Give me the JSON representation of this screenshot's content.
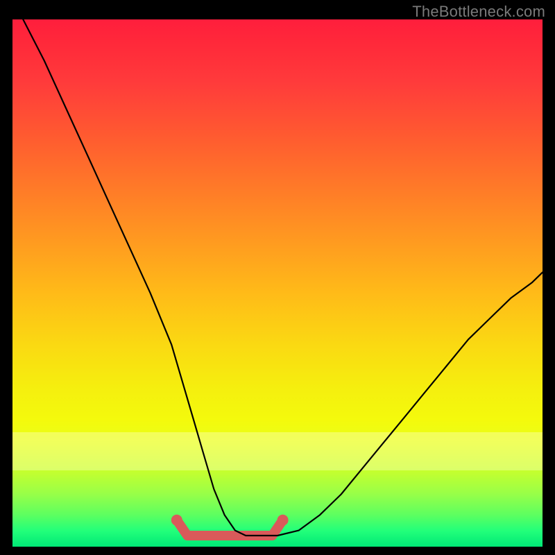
{
  "watermark": "TheBottleneck.com",
  "colors": {
    "curve": "#000000",
    "accent": "#d95a5a",
    "gradient_top": "#ff1e3c",
    "gradient_bottom": "#00e876"
  },
  "chart_data": {
    "type": "line",
    "title": "",
    "xlabel": "",
    "ylabel": "",
    "xlim": [
      0,
      100
    ],
    "ylim": [
      0,
      100
    ],
    "x": [
      2,
      6,
      10,
      14,
      18,
      22,
      26,
      30,
      32,
      34,
      36,
      38,
      40,
      42,
      44,
      46,
      50,
      54,
      58,
      62,
      66,
      70,
      74,
      78,
      82,
      86,
      90,
      94,
      98,
      100
    ],
    "values": [
      100,
      92,
      83,
      74,
      65,
      56,
      47,
      37,
      30,
      23,
      16,
      9,
      4,
      1,
      0,
      0,
      0,
      1,
      4,
      8,
      13,
      18,
      23,
      28,
      33,
      38,
      42,
      46,
      49,
      51
    ],
    "accent_range_x": [
      31,
      51
    ],
    "accent_y": 0,
    "notes": "V-shaped curve on a vertical rainbow heat gradient; minimum plateau highlighted with a thick coral segment and endpoint dots."
  }
}
